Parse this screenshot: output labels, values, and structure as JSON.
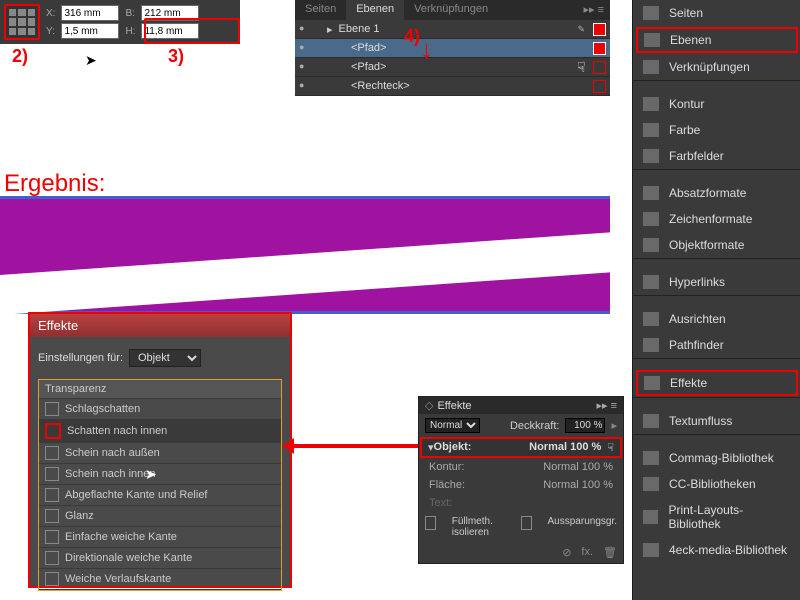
{
  "dims": {
    "x_lbl": "X:",
    "x": "316 mm",
    "y_lbl": "Y:",
    "y": "1,5 mm",
    "w_lbl": "B:",
    "w": "212 mm",
    "h_lbl": "H:",
    "h": "11,8 mm"
  },
  "ann": {
    "n2": "2)",
    "n3": "3)",
    "n4": "4)",
    "erg": "Ergebnis:"
  },
  "layers": {
    "tabs": [
      "Seiten",
      "Ebenen",
      "Verknüpfungen"
    ],
    "items": [
      "Ebene 1",
      "<Pfad>",
      "<Pfad>",
      "<Rechteck>"
    ]
  },
  "fxdlg": {
    "title": "Effekte",
    "settings_lbl": "Einstellungen für:",
    "settings_val": "Objekt",
    "list": [
      "Transparenz",
      "Schlagschatten",
      "Schatten nach innen",
      "Schein nach außen",
      "Schein nach innen",
      "Abgeflachte Kante und Relief",
      "Glanz",
      "Einfache weiche Kante",
      "Direktionale weiche Kante",
      "Weiche Verlaufskante"
    ]
  },
  "fxpnl": {
    "title": "Effekte",
    "mode": "Normal",
    "opac_lbl": "Deckkraft:",
    "opac": "100 %",
    "rows": [
      {
        "l": "Objekt:",
        "v": "Normal 100 %"
      },
      {
        "l": "Kontur:",
        "v": "Normal 100 %"
      },
      {
        "l": "Fläche:",
        "v": "Normal 100 %"
      },
      {
        "l": "Text:",
        "v": ""
      }
    ],
    "cb1": "Füllmeth. isolieren",
    "cb2": "Aussparungsgr."
  },
  "right": [
    "Seiten",
    "Ebenen",
    "Verknüpfungen",
    "",
    "Kontur",
    "Farbe",
    "Farbfelder",
    "",
    "Absatzformate",
    "Zeichenformate",
    "Objektformate",
    "",
    "Hyperlinks",
    "",
    "Ausrichten",
    "Pathfinder",
    "",
    "Effekte",
    "",
    "Textumfluss",
    "",
    "Commag-Bibliothek",
    "CC-Bibliotheken",
    "Print-Layouts-Bibliothek",
    "4eck-media-Bibliothek"
  ]
}
